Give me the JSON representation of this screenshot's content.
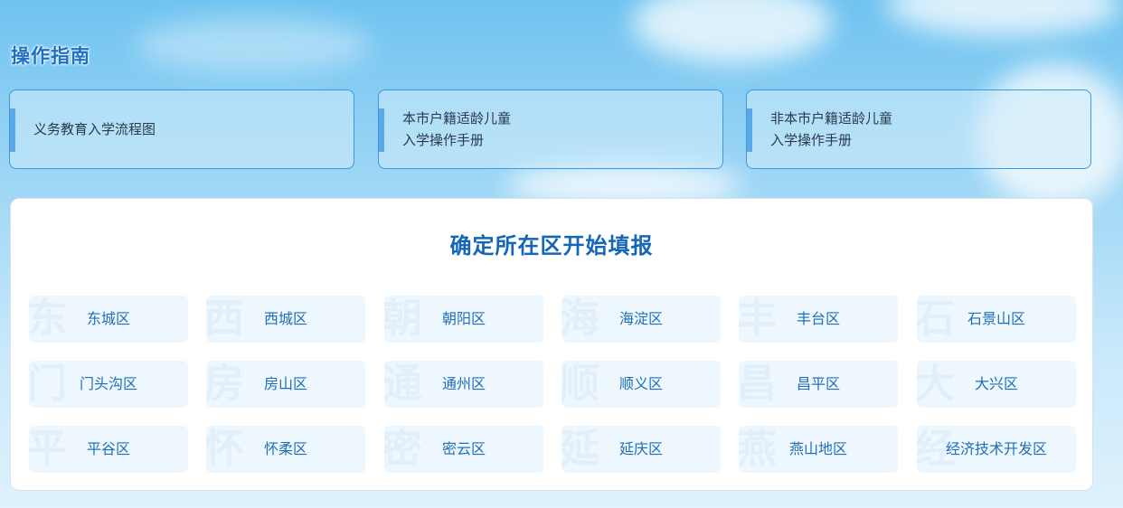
{
  "guide": {
    "title": "操作指南",
    "cards": [
      {
        "line1": "义务教育入学流程图",
        "line2": ""
      },
      {
        "line1": "本市户籍适龄儿童",
        "line2": "入学操作手册"
      },
      {
        "line1": "非本市户籍适龄儿童",
        "line2": "入学操作手册"
      }
    ]
  },
  "district_panel": {
    "title": "确定所在区开始填报",
    "districts": [
      {
        "watermark": "东",
        "label": "东城区"
      },
      {
        "watermark": "西",
        "label": "西城区"
      },
      {
        "watermark": "朝",
        "label": "朝阳区"
      },
      {
        "watermark": "海",
        "label": "海淀区"
      },
      {
        "watermark": "丰",
        "label": "丰台区"
      },
      {
        "watermark": "石",
        "label": "石景山区"
      },
      {
        "watermark": "门",
        "label": "门头沟区"
      },
      {
        "watermark": "房",
        "label": "房山区"
      },
      {
        "watermark": "通",
        "label": "通州区"
      },
      {
        "watermark": "顺",
        "label": "顺义区"
      },
      {
        "watermark": "昌",
        "label": "昌平区"
      },
      {
        "watermark": "大",
        "label": "大兴区"
      },
      {
        "watermark": "平",
        "label": "平谷区"
      },
      {
        "watermark": "怀",
        "label": "怀柔区"
      },
      {
        "watermark": "密",
        "label": "密云区"
      },
      {
        "watermark": "延",
        "label": "延庆区"
      },
      {
        "watermark": "燕",
        "label": "燕山地区"
      },
      {
        "watermark": "经",
        "label": "经济技术开发区"
      }
    ]
  },
  "colors": {
    "accent": "#1d6fc4",
    "card_border": "#3b99dc",
    "district_text": "#1f6fb8",
    "district_bg": "#eef7fd"
  }
}
